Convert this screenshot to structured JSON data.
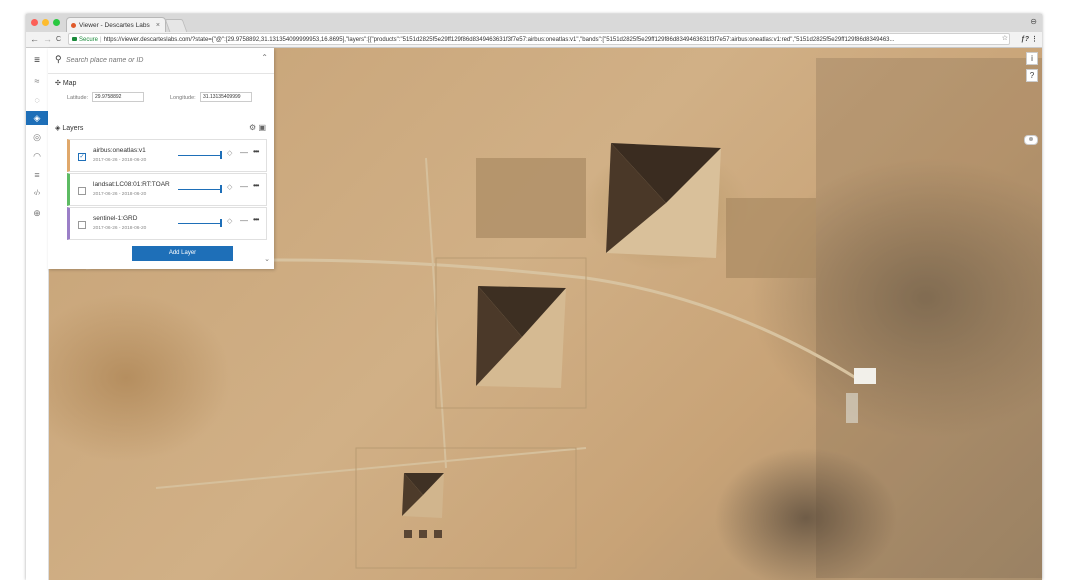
{
  "browser": {
    "tab_title": "Viewer - Descartes Labs",
    "tab_close": "×",
    "url_secure": "Secure",
    "url": "https://viewer.descarteslabs.com/?state={\"@\":[29.9758892,31.131354099999953,16.8695],\"layers\":[{\"products\":\"5151d2825f5e29ff129f86d8349463631f3f7e57:airbus:oneatlas:v1\",\"bands\":[\"5151d2825f5e29ff129f86d8349463631f3f7e57:airbus:oneatlas:v1:red\",\"5151d2825f5e29ff129f86d8349463...",
    "back": "←",
    "forward": "→",
    "reload": "C",
    "star": "☆",
    "ext": "ƒ?",
    "menu": "⋮",
    "profile": "⊖"
  },
  "sidebar": {
    "menu_icon": "≡",
    "icons": [
      "≈",
      "◌",
      "◈",
      "◎",
      "◠",
      "≡",
      "‹/›",
      "⊕"
    ]
  },
  "search": {
    "placeholder": "Search place name or ID",
    "icon": "🔍",
    "chevron": "⌃"
  },
  "map_section": {
    "title": "Map",
    "icon": "✣",
    "latitude_label": "Latitude:",
    "latitude_value": "29.9758892",
    "longitude_label": "Longitude:",
    "longitude_value": "31.13135409999"
  },
  "layers_section": {
    "title": "Layers",
    "icon": "◈",
    "layers": [
      {
        "name": "airbus:oneatlas:v1",
        "dates": "2017-06-26 - 2018-06-20",
        "checked": "✓",
        "color": "#e0a86b",
        "opacity": 1.0
      },
      {
        "name": "landsat:LC08:01:RT:TOAR",
        "dates": "2017-06-26 - 2018-06-20",
        "checked": "",
        "color": "#5dbb63",
        "opacity": 1.0
      },
      {
        "name": "sentinel-1:GRD",
        "dates": "2017-06-26 - 2018-06-20",
        "checked": "",
        "color": "#9b7fc7",
        "opacity": 1.0
      }
    ],
    "add_layer": "Add Layer",
    "chevron": "⌄"
  },
  "map_controls": {
    "info": "i",
    "help": "?"
  }
}
